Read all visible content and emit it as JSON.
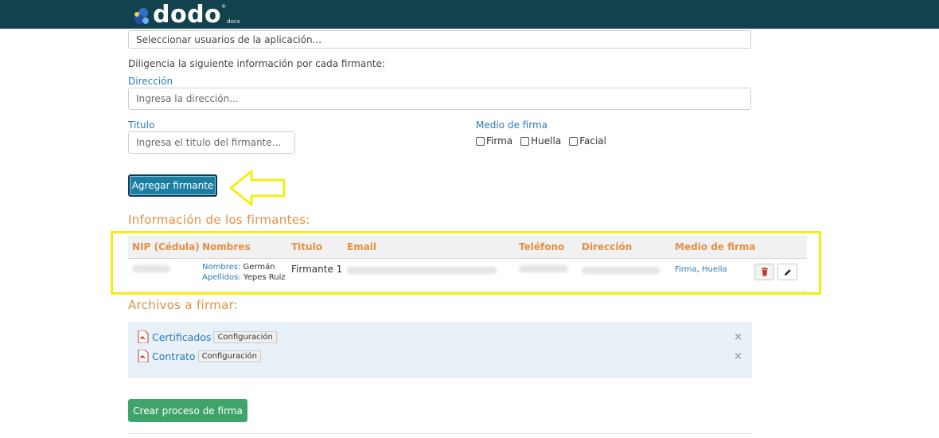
{
  "header": {
    "logo_text": "dodo",
    "logo_sub": "docs",
    "logo_reg": "®"
  },
  "form": {
    "users_select_placeholder": "Seleccionar usuarios de la aplicación...",
    "instruction": "Diligencia la siguiente información por cada firmante:",
    "direccion_label": "Dirección",
    "direccion_placeholder": "Ingresa la dirección...",
    "titulo_label": "Titulo",
    "titulo_placeholder": "Ingresa el titulo del firmante...",
    "medio_label": "Medio de firma",
    "medio_options": [
      "Firma",
      "Huella",
      "Facial"
    ],
    "add_button": "Agregar firmante"
  },
  "signers": {
    "section_title": "Información de los firmantes:",
    "columns": [
      "NIP (Cédula)",
      "Nombres",
      "Titulo",
      "Email",
      "Teléfono",
      "Dirección",
      "Medio de firma"
    ],
    "rows": [
      {
        "nombres_label": "Nombres:",
        "nombres_value": "Germán",
        "apellidos_label": "Apellidos:",
        "apellidos_value": "Yepes Ruiz",
        "titulo": "Firmante 1",
        "medio_firma_1": "Firma",
        "medio_sep": ",",
        "medio_firma_2": "Huella"
      }
    ]
  },
  "files": {
    "section_title": "Archivos a firmar:",
    "items": [
      {
        "name": "Certificados",
        "config": "Configuración",
        "remove": "×"
      },
      {
        "name": "Contrato",
        "config": "Configuración",
        "remove": "×"
      }
    ]
  },
  "actions": {
    "create_button": "Crear proceso de firma"
  },
  "colors": {
    "header_bg": "#12424e",
    "accent_orange": "#e39044",
    "link_blue": "#2a7bb6",
    "primary_btn": "#1b7fa3",
    "success_btn": "#3fa36b",
    "highlight_yellow": "#f4ee10"
  },
  "icons": [
    "dodo-logo-icon",
    "pointing-arrow-icon",
    "trash-icon",
    "pencil-icon",
    "pdf-file-icon",
    "close-icon"
  ]
}
